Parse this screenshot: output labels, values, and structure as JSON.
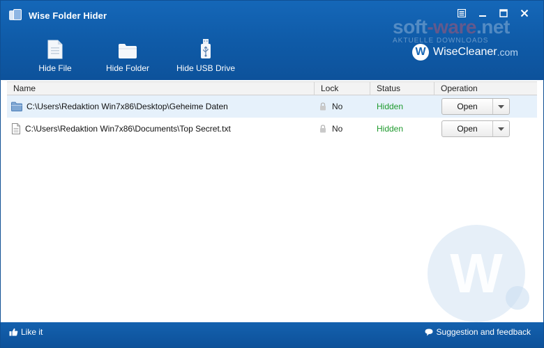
{
  "window": {
    "title": "Wise Folder Hider",
    "app_icon": "folder-hider-app-icon",
    "controls": [
      "menu-icon",
      "minimize-icon",
      "maximize-icon",
      "close-icon"
    ]
  },
  "toolbar": {
    "hide_file": "Hide File",
    "hide_folder": "Hide Folder",
    "hide_usb": "Hide USB Drive"
  },
  "watermark": {
    "site_a": "soft",
    "site_b": "-ware",
    "site_c": ".net",
    "site_sub": "AKTUELLE DOWNLOADS"
  },
  "brand": {
    "letter": "W",
    "name": "WiseCleaner",
    "tld": ".com"
  },
  "table": {
    "columns": [
      "Name",
      "Lock",
      "Status",
      "Operation"
    ],
    "rows": [
      {
        "icon": "folder-icon",
        "name": "C:\\Users\\Redaktion Win7x86\\Desktop\\Geheime Daten",
        "lock": "No",
        "status": "Hidden",
        "operation": "Open"
      },
      {
        "icon": "file-icon",
        "name": "C:\\Users\\Redaktion Win7x86\\Documents\\Top Secret.txt",
        "lock": "No",
        "status": "Hidden",
        "operation": "Open"
      }
    ]
  },
  "background_logo": {
    "letter": "W"
  },
  "footer": {
    "like": "Like it",
    "feedback": "Suggestion and feedback"
  },
  "colors": {
    "header": "#0f5ba8",
    "status_hidden": "#1f9a2e",
    "selected_row": "#e6f1fb"
  }
}
